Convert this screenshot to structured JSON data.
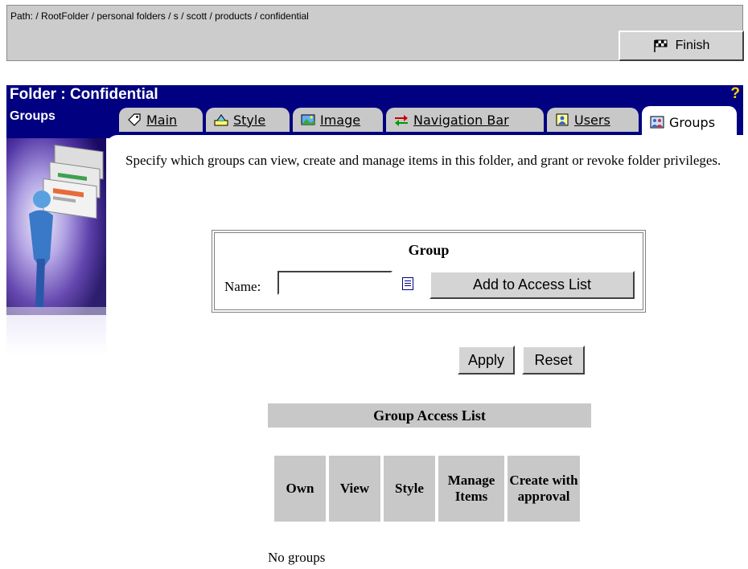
{
  "pathbar": {
    "path": "Path: / RootFolder / personal folders / s / scott / products / confidential",
    "finish_label": "Finish"
  },
  "header": {
    "title": "Folder : Confidential",
    "subtitle": "Groups",
    "help": "?"
  },
  "tabs": [
    {
      "label": "Main",
      "icon": "tag-icon"
    },
    {
      "label": "Style",
      "icon": "style-icon"
    },
    {
      "label": "Image",
      "icon": "image-icon"
    },
    {
      "label": "Navigation Bar",
      "icon": "navigation-arrows-icon"
    },
    {
      "label": "Users",
      "icon": "users-icon"
    },
    {
      "label": "Groups",
      "icon": "groups-icon",
      "active": true
    }
  ],
  "intro_text": "Specify which groups can view, create and manage items in this folder, and grant or revoke folder privileges.",
  "group_box": {
    "title": "Group",
    "name_label": "Name:",
    "name_value": "",
    "add_label": "Add to Access List"
  },
  "actions": {
    "apply_label": "Apply",
    "reset_label": "Reset"
  },
  "access_list": {
    "title": "Group Access List",
    "columns": [
      "Own",
      "View",
      "Style",
      "Manage Items",
      "Create with approval"
    ],
    "empty_text": "No groups"
  },
  "colors": {
    "header_bg": "#000080",
    "toolbar_bg": "#cccccc",
    "tab_bg": "#c8c8c8",
    "help_icon": "#ffd400"
  }
}
